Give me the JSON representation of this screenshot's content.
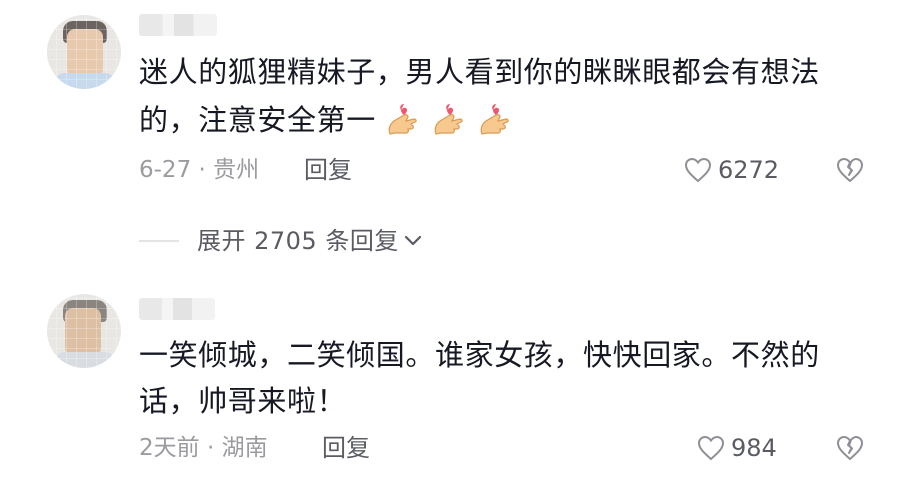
{
  "comments": [
    {
      "text": "迷人的狐狸精妹子，男人看到你的眯眯眼都会有想法的，注意安全第一",
      "line1": "迷人的狐狸精妹子，男人看到你的眯眯眼都会有想法",
      "line2": "的，注意安全第一",
      "emoji": [
        "finger-heart-emoji",
        "finger-heart-emoji",
        "finger-heart-emoji"
      ],
      "meta": "6-27 · 贵州",
      "reply_label": "回复",
      "likes": "6272"
    },
    {
      "text": "一笑倾城，二笑倾国。谁家女孩，快快回家。不然的话，帅哥来啦！",
      "line1": "一笑倾城，二笑倾国。谁家女孩，快快回家。不然的",
      "line2": "话，帅哥来啦！",
      "meta": "2天前 · 湖南",
      "reply_label": "回复",
      "likes": "984"
    }
  ],
  "expand_replies": {
    "label": "展开 2705 条回复"
  },
  "colors": {
    "text": "#161823",
    "meta": "#9b9b9f",
    "secondary": "#5a5b63",
    "heart_outline": "#9b9b9f"
  }
}
